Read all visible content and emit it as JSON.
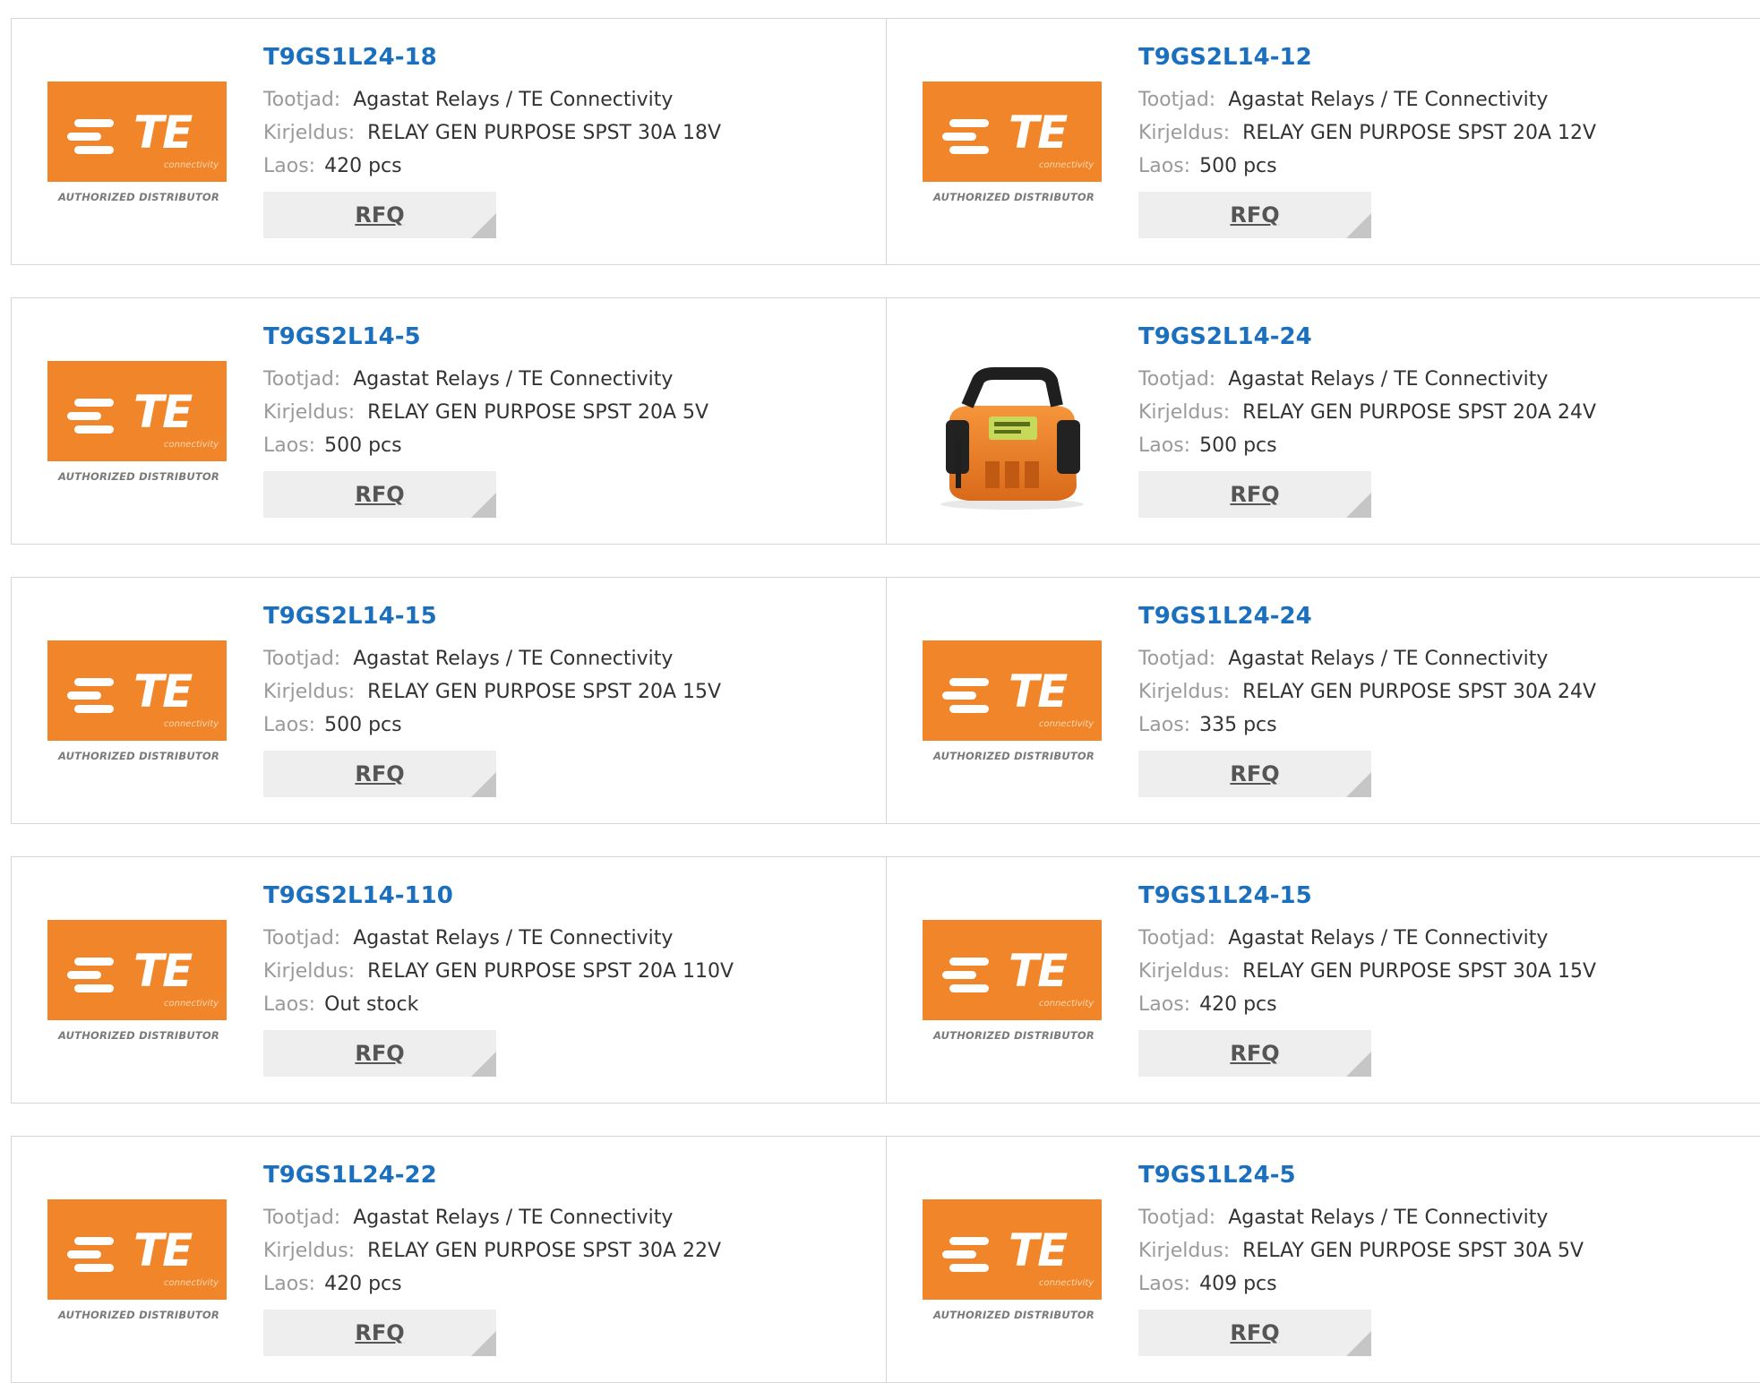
{
  "labels": {
    "manufacturer": "Tootjad:",
    "description": "Kirjeldus:",
    "stock": "Laos:",
    "rfq": "RFQ"
  },
  "logo": {
    "text": "TE",
    "sub": "connectivity",
    "caption": "AUTHORIZED DISTRIBUTOR",
    "color": "#f0852a"
  },
  "accent": "#1a6fbf",
  "products": [
    {
      "pn": "T9GS1L24-18",
      "manufacturer": "Agastat Relays / TE Connectivity",
      "description": "RELAY GEN PURPOSE SPST 30A 18V",
      "stock": "420 pcs",
      "image": "te-logo"
    },
    {
      "pn": "T9GS2L14-12",
      "manufacturer": "Agastat Relays / TE Connectivity",
      "description": "RELAY GEN PURPOSE SPST 20A 12V",
      "stock": "500 pcs",
      "image": "te-logo"
    },
    {
      "pn": "T9GS2L14-5",
      "manufacturer": "Agastat Relays / TE Connectivity",
      "description": "RELAY GEN PURPOSE SPST 20A 5V",
      "stock": "500 pcs",
      "image": "te-logo"
    },
    {
      "pn": "T9GS2L14-24",
      "manufacturer": "Agastat Relays / TE Connectivity",
      "description": "RELAY GEN PURPOSE SPST 20A 24V",
      "stock": "500 pcs",
      "image": "relay-photo"
    },
    {
      "pn": "T9GS2L14-15",
      "manufacturer": "Agastat Relays / TE Connectivity",
      "description": "RELAY GEN PURPOSE SPST 20A 15V",
      "stock": "500 pcs",
      "image": "te-logo"
    },
    {
      "pn": "T9GS1L24-24",
      "manufacturer": "Agastat Relays / TE Connectivity",
      "description": "RELAY GEN PURPOSE SPST 30A 24V",
      "stock": "335 pcs",
      "image": "te-logo"
    },
    {
      "pn": "T9GS2L14-110",
      "manufacturer": "Agastat Relays / TE Connectivity",
      "description": "RELAY GEN PURPOSE SPST 20A 110V",
      "stock": "Out stock",
      "image": "te-logo"
    },
    {
      "pn": "T9GS1L24-15",
      "manufacturer": "Agastat Relays / TE Connectivity",
      "description": "RELAY GEN PURPOSE SPST 30A 15V",
      "stock": "420 pcs",
      "image": "te-logo"
    },
    {
      "pn": "T9GS1L24-22",
      "manufacturer": "Agastat Relays / TE Connectivity",
      "description": "RELAY GEN PURPOSE SPST 30A 22V",
      "stock": "420 pcs",
      "image": "te-logo"
    },
    {
      "pn": "T9GS1L24-5",
      "manufacturer": "Agastat Relays / TE Connectivity",
      "description": "RELAY GEN PURPOSE SPST 30A 5V",
      "stock": "409 pcs",
      "image": "te-logo"
    }
  ]
}
